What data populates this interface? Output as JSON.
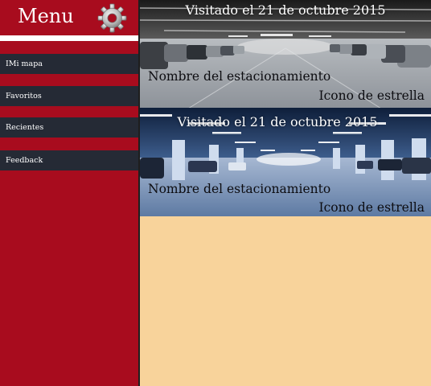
{
  "sidebar": {
    "title": "Menu",
    "settings_icon": "gear-icon",
    "items": [
      {
        "label": "IMi mapa"
      },
      {
        "label": "Favoritos"
      },
      {
        "label": "Recientes"
      },
      {
        "label": "Feedback"
      }
    ]
  },
  "cards": [
    {
      "visit_date": "Visitado el 21 de octubre 2015",
      "parking_name": "Nombre del estacionamiento",
      "star_icon_label": "Icono de estrella"
    },
    {
      "visit_date": "Visitado el 21 de octubre 2015",
      "parking_name": "Nombre del estacionamiento",
      "star_icon_label": "Icono de estrella"
    }
  ],
  "colors": {
    "sidebar_bg": "#a80c1e",
    "nav_item_bg": "#252a35",
    "content_bg": "#f8d39b"
  }
}
